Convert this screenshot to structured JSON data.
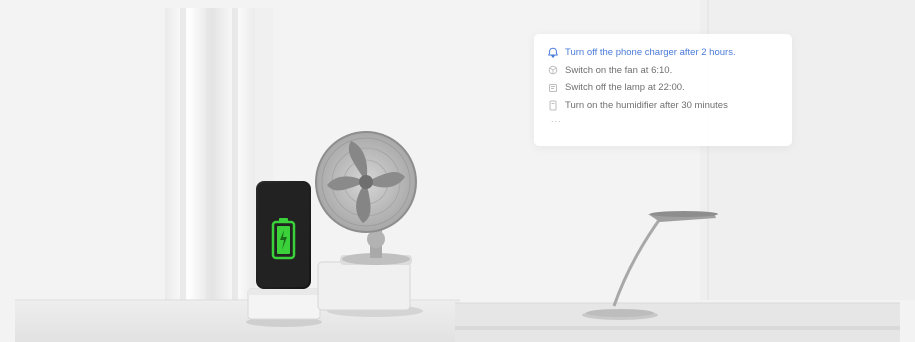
{
  "scene": {
    "objects": [
      "phone-charger",
      "desk-fan",
      "desk-lamp",
      "curtain"
    ],
    "accent_color": "#4a7bd8",
    "battery_color": "#3bd13b"
  },
  "task_panel": {
    "items": [
      {
        "label": "Turn off the phone charger after 2 hours.",
        "icon": "phone-icon",
        "active": true
      },
      {
        "label": "Switch on the fan at 6:10.",
        "icon": "fan-icon",
        "active": false
      },
      {
        "label": "Switch off the lamp at 22:00.",
        "icon": "lamp-icon",
        "active": false
      },
      {
        "label": "Turn on the humidifier after 30 minutes",
        "icon": "humidifier-icon",
        "active": false
      }
    ],
    "more": "..."
  }
}
